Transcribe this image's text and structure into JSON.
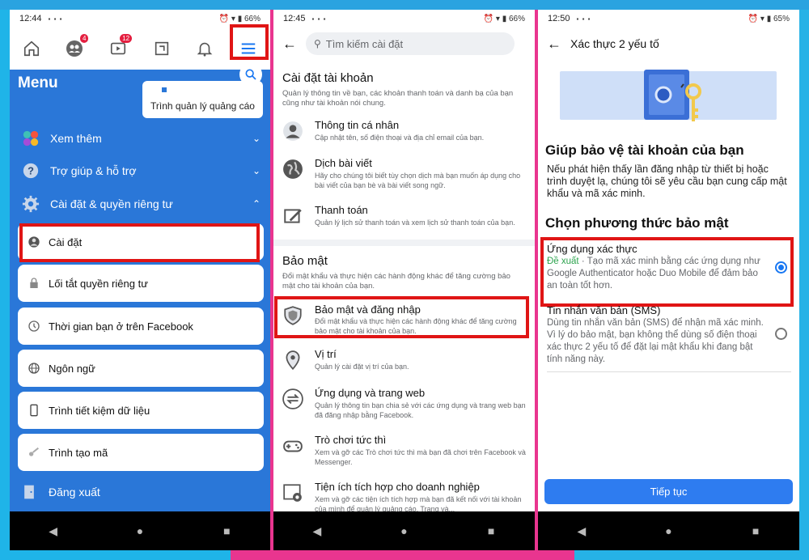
{
  "panel1": {
    "status_time": "12:44",
    "status_apps": "▪ ▪ ▪ ",
    "status_right": "⏰ ▾ ▮ 66%",
    "badge_friends": "4",
    "badge_watch": "12",
    "menu_title": "Menu",
    "ads_manager": "Trình quản lý quảng cáo",
    "see_more": "Xem thêm",
    "help": "Trợ giúp & hỗ trợ",
    "settings_privacy": "Cài đặt & quyền riêng tư",
    "items": [
      {
        "label": "Cài đặt"
      },
      {
        "label": "Lối tắt quyền riêng tư"
      },
      {
        "label": "Thời gian bạn ở trên Facebook"
      },
      {
        "label": "Ngôn ngữ"
      },
      {
        "label": "Trình tiết kiệm dữ liệu"
      },
      {
        "label": "Trình tạo mã"
      }
    ],
    "logout": "Đăng xuất"
  },
  "panel2": {
    "status_time": "12:45",
    "status_right": "⏰ ▾ ▮ 66%",
    "search_placeholder": "Tìm kiếm cài đặt",
    "account_title": "Cài đặt tài khoản",
    "account_desc": "Quản lý thông tin về bạn, các khoản thanh toán và danh bạ của bạn cũng như tài khoản nói chung.",
    "account_rows": [
      {
        "title": "Thông tin cá nhân",
        "desc": "Cập nhật tên, số điện thoại và địa chỉ email của bạn."
      },
      {
        "title": "Dịch bài viết",
        "desc": "Hãy cho chúng tôi biết tùy chọn dịch mà bạn muốn áp dụng cho bài viết của bạn bè và bài viết song ngữ."
      },
      {
        "title": "Thanh toán",
        "desc": "Quản lý lịch sử thanh toán và xem lịch sử thanh toán của bạn."
      }
    ],
    "security_title": "Bảo mật",
    "security_desc": "Đổi mật khẩu và thực hiện các hành động khác để tăng cường bảo mật cho tài khoản của bạn.",
    "security_rows": [
      {
        "title": "Bảo mật và đăng nhập",
        "desc": "Đổi mật khẩu và thực hiện các hành động khác để tăng cường bảo mật cho tài khoản của bạn."
      },
      {
        "title": "Vị trí",
        "desc": "Quản lý cài đặt vị trí của bạn."
      },
      {
        "title": "Ứng dụng và trang web",
        "desc": "Quản lý thông tin bạn chia sẻ với các ứng dụng và trang web bạn đã đăng nhập bằng Facebook."
      },
      {
        "title": "Trò chơi tức thì",
        "desc": "Xem và gỡ các Trò chơi tức thì mà bạn đã chơi trên Facebook và Messenger."
      },
      {
        "title": "Tiện ích tích hợp cho doanh nghiệp",
        "desc": "Xem và gỡ các tiện ích tích hợp mà bạn đã kết nối với tài khoản của mình để quản lý quảng cáo. Trang và..."
      }
    ]
  },
  "panel3": {
    "status_time": "12:50",
    "status_right": "⏰ ▾ ▮ 65%",
    "header": "Xác thực 2 yếu tố",
    "heading": "Giúp bảo vệ tài khoản của bạn",
    "intro": "Nếu phát hiện thấy lần đăng nhập từ thiết bị hoặc trình duyệt lạ, chúng tôi sẽ yêu cầu bạn cung cấp mật khẩu và mã xác minh.",
    "choose": "Chọn phương thức bảo mật",
    "option1_title": "Ứng dụng xác thực",
    "option1_recommended": "Đề xuất",
    "option1_desc": " · Tạo mã xác minh bằng các ứng dụng như Google Authenticator hoặc Duo Mobile để đảm bảo an toàn tốt hơn.",
    "option2_title": "Tin nhắn văn bản (SMS)",
    "option2_desc": "Dùng tin nhắn văn bản (SMS) để nhận mã xác minh. Vì lý do bảo mật, bạn không thể dùng số điện thoại xác thực 2 yếu tố để đặt lại mật khẩu khi đang bật tính năng này.",
    "continue": "Tiếp tục"
  },
  "colors": {
    "facebook_blue": "#1877f2",
    "menu_blue": "#2a77d8",
    "highlight_red": "#e01515"
  }
}
